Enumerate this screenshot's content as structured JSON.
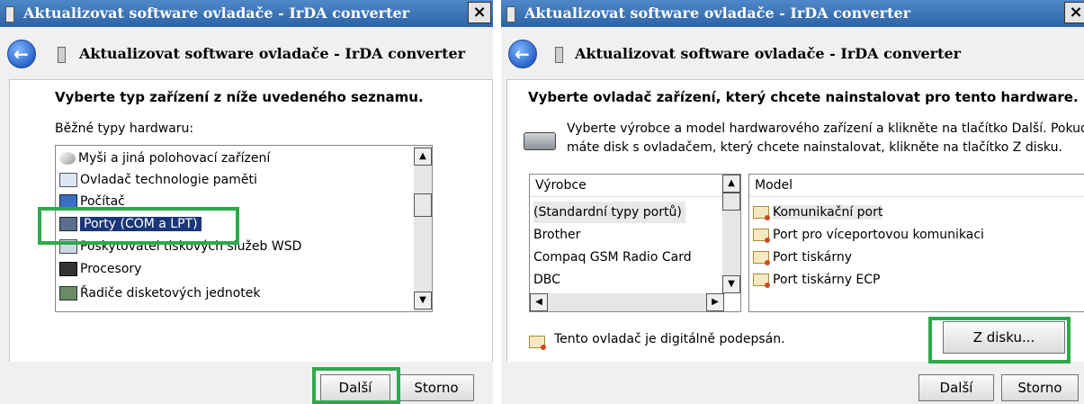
{
  "left_dialog": {
    "window_title": "Aktualizovat software ovladače - IrDA converter",
    "close_label": "×",
    "header_title": "Aktualizovat software ovladače - IrDA converter",
    "heading": "Vyberte typ zařízení z níže uvedeného seznamu.",
    "list_label": "Běžné typy hardwaru:",
    "items": [
      {
        "label": "Myši a jiná polohovací zařízení",
        "icon": "mouse-icon"
      },
      {
        "label": "Ovladač technologie paměti",
        "icon": "memory-icon"
      },
      {
        "label": "Počítač",
        "icon": "computer-icon"
      },
      {
        "label": "Porty (COM a LPT)",
        "icon": "port-icon",
        "selected": true
      },
      {
        "label": "Poskytovatel tiskových služeb WSD",
        "icon": "printer-icon"
      },
      {
        "label": "Procesory",
        "icon": "processor-icon"
      },
      {
        "label": "Řadiče disketových jednotek",
        "icon": "floppy-controller-icon"
      }
    ],
    "next_button": "Další",
    "cancel_button": "Storno"
  },
  "right_dialog": {
    "window_title": "Aktualizovat software ovladače - IrDA converter",
    "close_label": "×",
    "header_title": "Aktualizovat software ovladače - IrDA converter",
    "heading": "Vyberte ovladač zařízení, který chcete nainstalovat pro tento hardware.",
    "instruction_line1": "Vyberte výrobce a model hardwarového zařízení a klikněte na tlačítko Další. Pokud",
    "instruction_line2": "máte disk s ovladačem, který chcete nainstalovat, klikněte na tlačítko Z disku.",
    "manufacturer_header": "Výrobce",
    "manufacturers": [
      "(Standardní typy portů)",
      "Brother",
      "Compaq GSM Radio Card",
      "DBC"
    ],
    "model_header": "Model",
    "models": [
      "Komunikační port",
      "Port pro víceportovou komunikaci",
      "Port tiskárny",
      "Port tiskárny ECP"
    ],
    "signed_text": "Tento ovladač je digitálně podepsán.",
    "have_disk_button": "Z disku...",
    "next_button": "Další",
    "cancel_button": "Storno"
  },
  "colors": {
    "highlight": "#2daa4a",
    "selection": "#1a3778",
    "titlebar": "#3a72b8"
  }
}
